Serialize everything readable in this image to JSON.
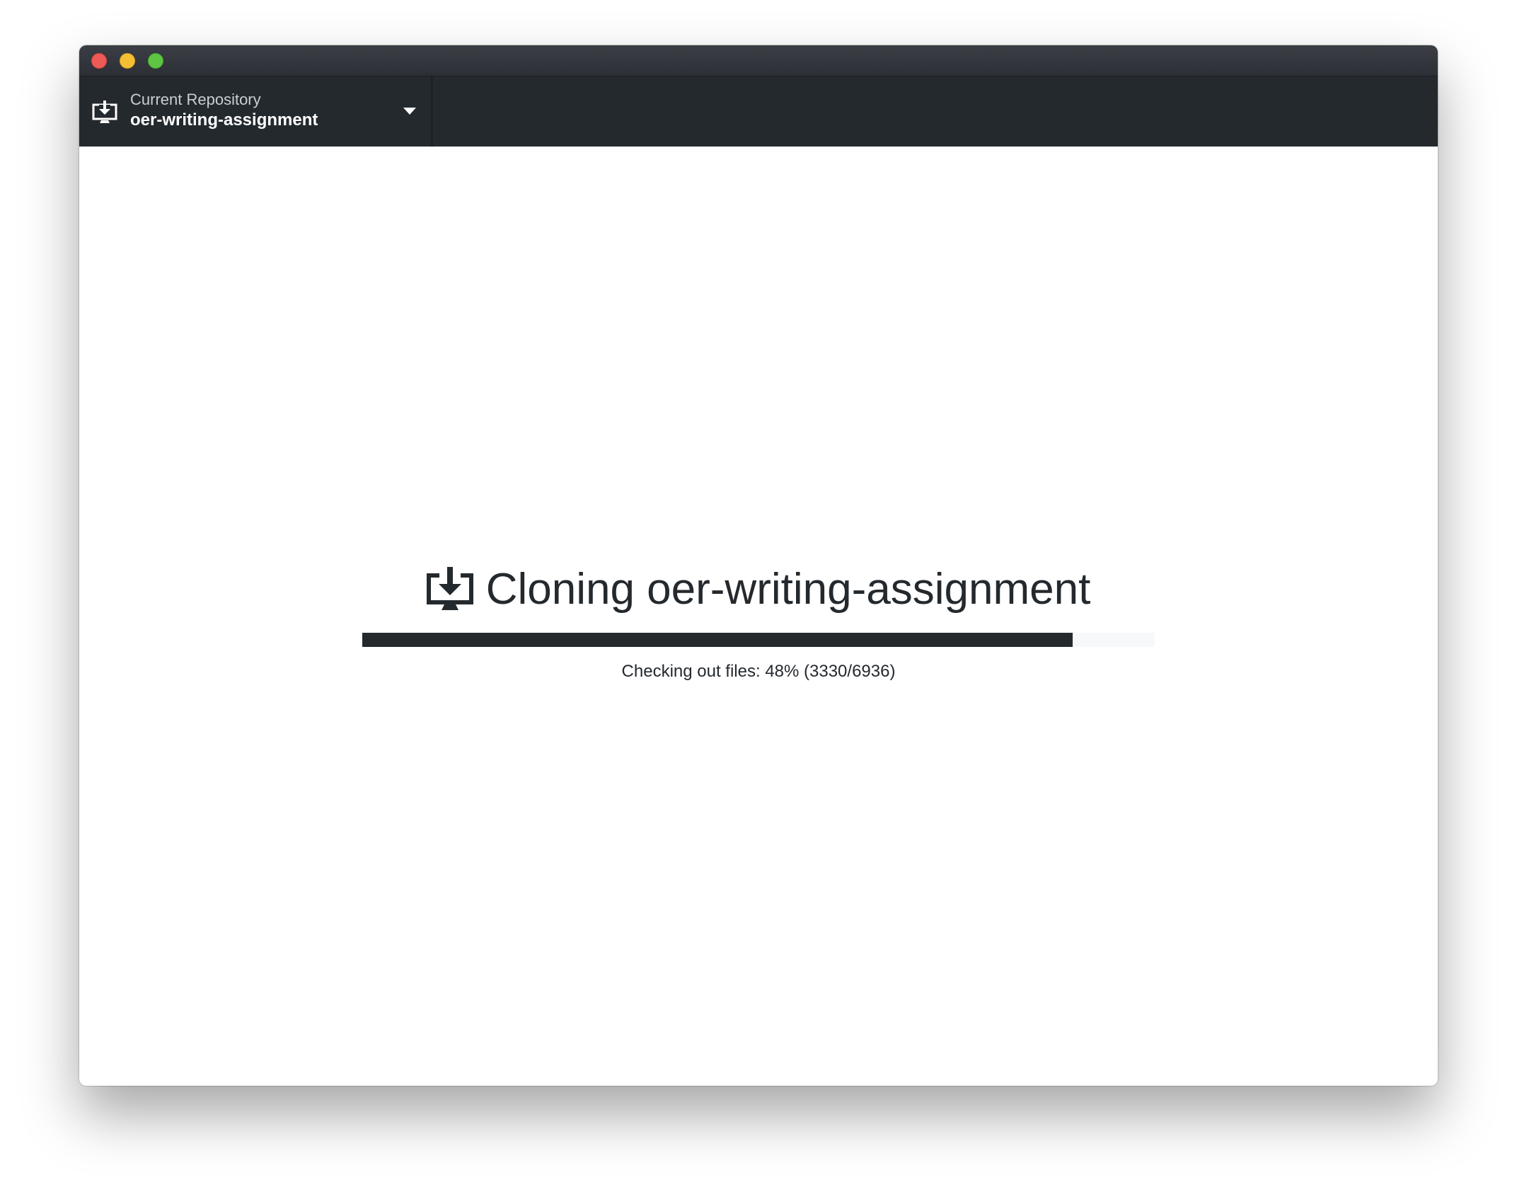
{
  "window": {
    "controls": [
      "close",
      "minimize",
      "maximize"
    ]
  },
  "toolbar": {
    "repository": {
      "label": "Current Repository",
      "name": "oer-writing-assignment",
      "icon": "clone-download-icon"
    }
  },
  "main": {
    "title": "Cloning oer-writing-assignment",
    "icon": "clone-download-icon",
    "progress": {
      "fraction": 0.896,
      "status_text": "Checking out files: 48% (3330/6936)"
    }
  },
  "colors": {
    "toolbar_bg": "#24292e",
    "progress_fill": "#24292e",
    "progress_track": "#f6f8fa",
    "close": "#ee5b56",
    "minimize": "#f5be33",
    "maximize": "#5fc443"
  }
}
